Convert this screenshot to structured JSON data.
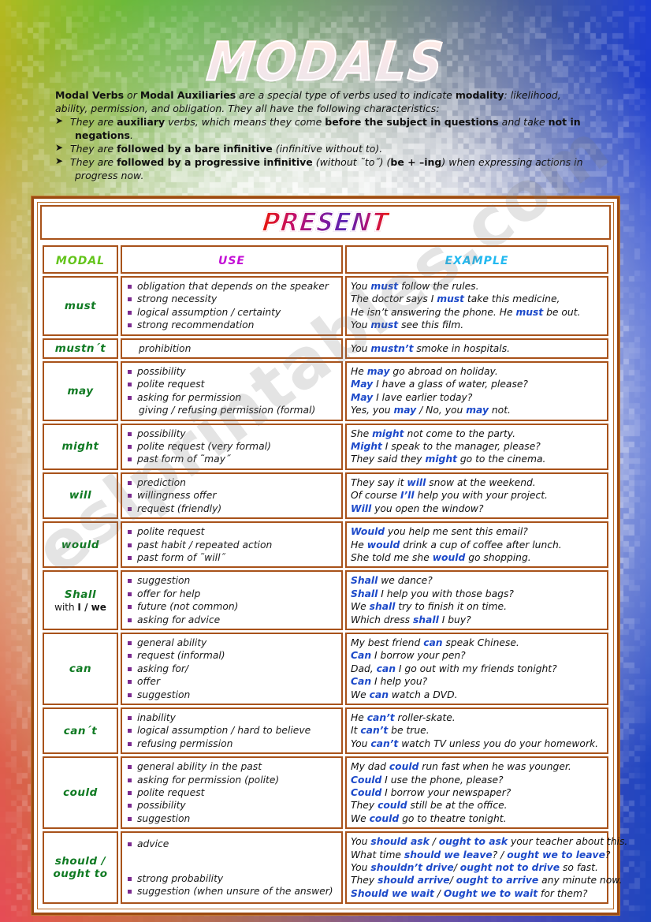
{
  "page": {
    "title": "MODALS",
    "watermark": "eslprintables.com"
  },
  "intro": {
    "line1_a": "Modal Verbs",
    "line1_b": " or ",
    "line1_c": "Modal Auxiliaries",
    "line1_d": " are a special type of verbs used to indicate ",
    "line1_e": "modality",
    "line1_f": ": likelihood,",
    "line2": "ability,  permission, and obligation. They  all have the following characteristics:",
    "b1_a": "They are ",
    "b1_b": "auxiliary",
    "b1_c": " verbs, which means they come ",
    "b1_d": "before the subject in questions",
    "b1_e": " and take ",
    "b1_f": "not in",
    "b1_g": "negations",
    "b1_h": ".",
    "b2_a": "They are ",
    "b2_b": "followed by a bare infinitive",
    "b2_c": " (infinitive without to).",
    "b3_a": "They are ",
    "b3_b": "followed by a progressive infinitive",
    "b3_c": " (without ˜to˝) (",
    "b3_d": "be + –ing",
    "b3_e": ") when expressing actions in",
    "b3_f": "progress now.",
    "arrow_glyph": "➤"
  },
  "table": {
    "banner": "PRESENT",
    "headers": {
      "modal": "MODAL",
      "use": "USE",
      "example": "EXAMPLE"
    },
    "rows": [
      {
        "modal": "must",
        "modal_sub": "",
        "uses": [
          {
            "text": "obligation that depends on the speaker",
            "bullet": true
          },
          {
            "text": "strong necessity",
            "bullet": true
          },
          {
            "text": "logical assumption / certainty",
            "bullet": true
          },
          {
            "text": "strong recommendation",
            "bullet": true
          }
        ],
        "examples": [
          [
            {
              "t": "You ",
              "hl": false
            },
            {
              "t": "must",
              "hl": true
            },
            {
              "t": " follow the rules.",
              "hl": false
            }
          ],
          [
            {
              "t": "The doctor says I ",
              "hl": false
            },
            {
              "t": "must",
              "hl": true
            },
            {
              "t": " take this medicine,",
              "hl": false
            }
          ],
          [
            {
              "t": "He isn’t answering the phone. He ",
              "hl": false
            },
            {
              "t": "must",
              "hl": true
            },
            {
              "t": " be out.",
              "hl": false
            }
          ],
          [
            {
              "t": "You ",
              "hl": false
            },
            {
              "t": "must",
              "hl": true
            },
            {
              "t": " see this film.",
              "hl": false
            }
          ]
        ]
      },
      {
        "modal": "mustn´t",
        "modal_sub": "",
        "uses": [
          {
            "text": "prohibition",
            "bullet": false
          }
        ],
        "examples": [
          [
            {
              "t": "You ",
              "hl": false
            },
            {
              "t": "mustn’t",
              "hl": true
            },
            {
              "t": " smoke in hospitals.",
              "hl": false
            }
          ]
        ]
      },
      {
        "modal": "may",
        "modal_sub": "",
        "uses": [
          {
            "text": "possibility",
            "bullet": true
          },
          {
            "text": "polite request",
            "bullet": true
          },
          {
            "text": "asking for  permission",
            "bullet": true
          },
          {
            "text": "giving / refusing permission (formal)",
            "bullet": false
          }
        ],
        "examples": [
          [
            {
              "t": "He ",
              "hl": false
            },
            {
              "t": "may",
              "hl": true
            },
            {
              "t": "  go abroad on holiday.",
              "hl": false
            }
          ],
          [
            {
              "t": "May",
              "hl": true
            },
            {
              "t": " I have a glass of water, please?",
              "hl": false
            }
          ],
          [
            {
              "t": "May",
              "hl": true
            },
            {
              "t": " I lave earlier today?",
              "hl": false
            }
          ],
          [
            {
              "t": "Yes, you ",
              "hl": false
            },
            {
              "t": "may",
              "hl": true
            },
            {
              "t": " / No, you ",
              "hl": false
            },
            {
              "t": "may",
              "hl": true
            },
            {
              "t": " not.",
              "hl": false
            }
          ]
        ]
      },
      {
        "modal": "might",
        "modal_sub": "",
        "uses": [
          {
            "text": "possibility",
            "bullet": true
          },
          {
            "text": "polite request (very formal)",
            "bullet": true
          },
          {
            "text": "past form of ˜may˝",
            "bullet": true
          }
        ],
        "examples": [
          [
            {
              "t": "She ",
              "hl": false
            },
            {
              "t": "might",
              "hl": true
            },
            {
              "t": " not come to the party.",
              "hl": false
            }
          ],
          [
            {
              "t": "Might",
              "hl": true
            },
            {
              "t": " I speak to the manager, please?",
              "hl": false
            }
          ],
          [
            {
              "t": "They said they ",
              "hl": false
            },
            {
              "t": "might",
              "hl": true
            },
            {
              "t": " go to the cinema.",
              "hl": false
            }
          ]
        ]
      },
      {
        "modal": "will",
        "modal_sub": "",
        "uses": [
          {
            "text": "prediction",
            "bullet": true
          },
          {
            "text": "willingness offer",
            "bullet": true
          },
          {
            "text": "request (friendly)",
            "bullet": true
          }
        ],
        "examples": [
          [
            {
              "t": "They say it ",
              "hl": false
            },
            {
              "t": "will",
              "hl": true
            },
            {
              "t": " snow at the weekend.",
              "hl": false
            }
          ],
          [
            {
              "t": "Of course ",
              "hl": false
            },
            {
              "t": "I’ll",
              "hl": true
            },
            {
              "t": " help you with your project.",
              "hl": false
            }
          ],
          [
            {
              "t": "Will",
              "hl": true
            },
            {
              "t": " you open the window?",
              "hl": false
            }
          ]
        ]
      },
      {
        "modal": "would",
        "modal_sub": "",
        "uses": [
          {
            "text": "polite request",
            "bullet": true
          },
          {
            "text": "past habit / repeated action",
            "bullet": true
          },
          {
            "text": "past form of ˜will˝",
            "bullet": true
          }
        ],
        "examples": [
          [
            {
              "t": "Would",
              "hl": true
            },
            {
              "t": " you help me sent this email?",
              "hl": false
            }
          ],
          [
            {
              "t": "He ",
              "hl": false
            },
            {
              "t": "would",
              "hl": true
            },
            {
              "t": " drink a cup of coffee after lunch.",
              "hl": false
            }
          ],
          [
            {
              "t": "She told me she ",
              "hl": false
            },
            {
              "t": "would",
              "hl": true
            },
            {
              "t": " go shopping.",
              "hl": false
            }
          ]
        ]
      },
      {
        "modal": "Shall",
        "modal_sub": "with I / we",
        "uses": [
          {
            "text": "suggestion",
            "bullet": true
          },
          {
            "text": "offer for help",
            "bullet": true
          },
          {
            "text": "future (not common)",
            "bullet": true
          },
          {
            "text": "asking for advice",
            "bullet": true
          }
        ],
        "examples": [
          [
            {
              "t": "Shall",
              "hl": true
            },
            {
              "t": " we dance?",
              "hl": false
            }
          ],
          [
            {
              "t": "Shall",
              "hl": true
            },
            {
              "t": " I help you with those bags?",
              "hl": false
            }
          ],
          [
            {
              "t": "We ",
              "hl": false
            },
            {
              "t": "shall",
              "hl": true
            },
            {
              "t": " try to finish it on time.",
              "hl": false
            }
          ],
          [
            {
              "t": "Which dress ",
              "hl": false
            },
            {
              "t": "shall",
              "hl": true
            },
            {
              "t": " I buy?",
              "hl": false
            }
          ]
        ]
      },
      {
        "modal": "can",
        "modal_sub": "",
        "uses": [
          {
            "text": "general ability",
            "bullet": true
          },
          {
            "text": "request (informal)",
            "bullet": true
          },
          {
            "text": "asking for/",
            "bullet": true
          },
          {
            "text": "offer",
            "bullet": true
          },
          {
            "text": "suggestion",
            "bullet": true
          }
        ],
        "examples": [
          [
            {
              "t": "My best friend ",
              "hl": false
            },
            {
              "t": "can",
              "hl": true
            },
            {
              "t": " speak Chinese.",
              "hl": false
            }
          ],
          [
            {
              "t": "Can",
              "hl": true
            },
            {
              "t": " I borrow your pen?",
              "hl": false
            }
          ],
          [
            {
              "t": "Dad, ",
              "hl": false
            },
            {
              "t": "can",
              "hl": true
            },
            {
              "t": " I go out with my friends tonight?",
              "hl": false
            }
          ],
          [
            {
              "t": "Can",
              "hl": true
            },
            {
              "t": " I help you?",
              "hl": false
            }
          ],
          [
            {
              "t": "We ",
              "hl": false
            },
            {
              "t": "can",
              "hl": true
            },
            {
              "t": " watch a DVD.",
              "hl": false
            }
          ]
        ]
      },
      {
        "modal": "can´t",
        "modal_sub": "",
        "uses": [
          {
            "text": "inability",
            "bullet": true
          },
          {
            "text": "logical assumption / hard to believe",
            "bullet": true
          },
          {
            "text": "refusing permission",
            "bullet": true
          }
        ],
        "examples": [
          [
            {
              "t": "He ",
              "hl": false
            },
            {
              "t": "can’t",
              "hl": true
            },
            {
              "t": " roller-skate.",
              "hl": false
            }
          ],
          [
            {
              "t": "It ",
              "hl": false
            },
            {
              "t": "can’t",
              "hl": true
            },
            {
              "t": " be true.",
              "hl": false
            }
          ],
          [
            {
              "t": "You ",
              "hl": false
            },
            {
              "t": "can’t",
              "hl": true
            },
            {
              "t": " watch TV unless you do your homework.",
              "hl": false
            }
          ]
        ]
      },
      {
        "modal": "could",
        "modal_sub": "",
        "uses": [
          {
            "text": "general ability in the past",
            "bullet": true
          },
          {
            "text": "asking for  permission (polite)",
            "bullet": true
          },
          {
            "text": "polite request",
            "bullet": true
          },
          {
            "text": "possibility",
            "bullet": true
          },
          {
            "text": "suggestion",
            "bullet": true
          }
        ],
        "examples": [
          [
            {
              "t": "My dad ",
              "hl": false
            },
            {
              "t": "could",
              "hl": true
            },
            {
              "t": " run fast when he was younger.",
              "hl": false
            }
          ],
          [
            {
              "t": "Could",
              "hl": true
            },
            {
              "t": " I use the phone, please?",
              "hl": false
            }
          ],
          [
            {
              "t": "Could",
              "hl": true
            },
            {
              "t": " I borrow your newspaper?",
              "hl": false
            }
          ],
          [
            {
              "t": "They ",
              "hl": false
            },
            {
              "t": "could",
              "hl": true
            },
            {
              "t": " still be at the office.",
              "hl": false
            }
          ],
          [
            {
              "t": "We ",
              "hl": false
            },
            {
              "t": "could",
              "hl": true
            },
            {
              "t": " go to theatre tonight.",
              "hl": false
            }
          ]
        ]
      },
      {
        "modal": "should /",
        "modal_sub2": "ought to",
        "uses": [
          {
            "text": "advice",
            "bullet": true
          },
          {
            "text": "strong probability",
            "bullet": true,
            "gap": true
          },
          {
            "text": "suggestion (when unsure of the answer)",
            "bullet": true
          }
        ],
        "examples": [
          [
            {
              "t": "You ",
              "hl": false
            },
            {
              "t": "should ask",
              "hl": true
            },
            {
              "t": " / ",
              "hl": false
            },
            {
              "t": "ought to ask",
              "hl": true
            },
            {
              "t": " your teacher about this.",
              "hl": false
            }
          ],
          [
            {
              "t": "What time ",
              "hl": false
            },
            {
              "t": "should we leave",
              "hl": true
            },
            {
              "t": "? / ",
              "hl": false
            },
            {
              "t": "ought we to leave",
              "hl": true
            },
            {
              "t": "?",
              "hl": false
            }
          ],
          [
            {
              "t": "You ",
              "hl": false
            },
            {
              "t": "shouldn’t drive",
              "hl": true
            },
            {
              "t": "/ ",
              "hl": false
            },
            {
              "t": "ought not to drive",
              "hl": true
            },
            {
              "t": " so fast.",
              "hl": false
            }
          ],
          [
            {
              "t": "They ",
              "hl": false
            },
            {
              "t": "should arrive",
              "hl": true
            },
            {
              "t": "/ ",
              "hl": false
            },
            {
              "t": "ought to arrive",
              "hl": true
            },
            {
              "t": " any minute now.",
              "hl": false
            }
          ],
          [
            {
              "t": "Should we wait",
              "hl": true
            },
            {
              "t": " / ",
              "hl": false
            },
            {
              "t": "Ought we to wait",
              "hl": true
            },
            {
              "t": " for them?",
              "hl": false
            }
          ]
        ]
      }
    ]
  },
  "colors": {
    "frame": "#a8521a",
    "modal_name": "#0f7a22",
    "header_modal": "#63c41b",
    "header_use": "#c310d6",
    "header_example": "#23b9f0",
    "highlight": "#1c49c9",
    "bullet": "#7b2a8f"
  }
}
